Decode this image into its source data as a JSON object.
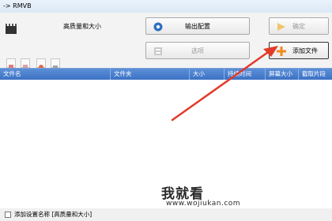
{
  "window": {
    "title": "-> RMVB"
  },
  "profile": {
    "label": "高质量和大小"
  },
  "buttons": {
    "output_config": "输出配置",
    "ok": "确定",
    "options": "选项",
    "add_file": "添加文件"
  },
  "table": {
    "columns": [
      "文件名",
      "文件夹",
      "大小",
      "持续时间",
      "屏幕大小",
      "截取片段"
    ]
  },
  "footer": {
    "add_setting": "添加设置名称 [高质量和大小]"
  },
  "watermark": {
    "brand": "我就看",
    "url": "www.wojiukan.com"
  },
  "colors": {
    "header_blue": "#4a7fcf",
    "arrow_red": "#e33a2a",
    "plus_orange": "#f08a1c"
  }
}
